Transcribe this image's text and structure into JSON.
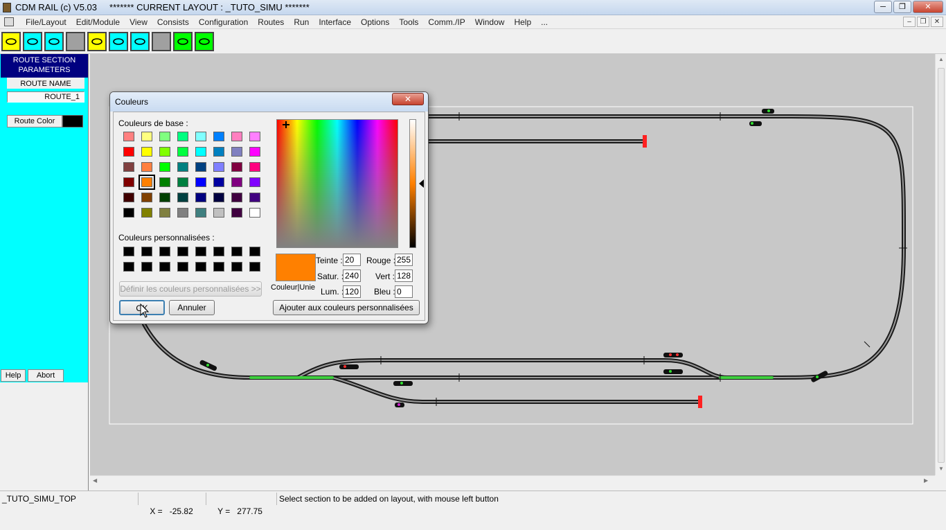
{
  "window": {
    "title": "CDM RAIL (c) V5.03     ******* CURRENT LAYOUT : _TUTO_SIMU *******",
    "minimize": "─",
    "maximize": "❐",
    "close": "✕"
  },
  "menu": {
    "items": [
      "File/Layout",
      "Edit/Module",
      "View",
      "Consists",
      "Configuration",
      "Routes",
      "Run",
      "Interface",
      "Options",
      "Tools",
      "Comm./IP",
      "Window",
      "Help",
      "..."
    ],
    "mdi_minimize": "‒",
    "mdi_restore": "❐",
    "mdi_close": "✕"
  },
  "toolbar": {
    "tools": [
      {
        "name": "loop-route-tool-icon",
        "color": "#ffff00"
      },
      {
        "name": "loop-alt-route-tool-icon",
        "color": "#00ffff"
      },
      {
        "name": "cross-loop-tool-icon",
        "color": "#00ffff"
      },
      {
        "name": "blank-tool-icon",
        "color": "#a0a0a0"
      },
      {
        "name": "buffer-stop-tool-icon",
        "color": "#ffff00"
      },
      {
        "name": "switch-track-tool-icon",
        "color": "#00ffff"
      },
      {
        "name": "cross-switch-tool-icon",
        "color": "#00ffff"
      },
      {
        "name": "blank-tool-icon-2",
        "color": "#a0a0a0"
      },
      {
        "name": "multi-track-tool-icon",
        "color": "#00ff00"
      },
      {
        "name": "oval-tool-icon",
        "color": "#00ff00"
      }
    ]
  },
  "left_panel": {
    "header_line1": "ROUTE SECTION",
    "header_line2": "PARAMETERS",
    "route_name_label": "ROUTE NAME",
    "route_name_value": "ROUTE_1",
    "route_color_button": "Route Color",
    "route_color": "#000000",
    "help_button": "Help",
    "abort_button": "Abort"
  },
  "status": {
    "layout_name": "_TUTO_SIMU_TOP",
    "x_label": "X =",
    "x_value": "-25.82",
    "y_label": "Y =",
    "y_value": "277.75",
    "message": "Select section to be added on layout, with mouse left button"
  },
  "dialog": {
    "title": "Couleurs",
    "close": "✕",
    "basic_colors_label": "Couleurs de base :",
    "basic_colors": [
      [
        "#ff8080",
        "#ffff80",
        "#80ff80",
        "#00ff80",
        "#80ffff",
        "#0080ff",
        "#ff80c0",
        "#ff80ff"
      ],
      [
        "#ff0000",
        "#ffff00",
        "#80ff00",
        "#00ff40",
        "#00ffff",
        "#0080c0",
        "#8080c0",
        "#ff00ff"
      ],
      [
        "#804040",
        "#ff8040",
        "#00ff00",
        "#008080",
        "#004080",
        "#8080ff",
        "#800040",
        "#ff0080"
      ],
      [
        "#800000",
        "#ff8000",
        "#008000",
        "#008040",
        "#0000ff",
        "#0000a0",
        "#800080",
        "#8000ff"
      ],
      [
        "#400000",
        "#804000",
        "#004000",
        "#004040",
        "#000080",
        "#000040",
        "#400040",
        "#400080"
      ],
      [
        "#000000",
        "#808000",
        "#808040",
        "#808080",
        "#408080",
        "#c0c0c0",
        "#400040",
        "#ffffff"
      ]
    ],
    "selected_row": 3,
    "selected_col": 1,
    "custom_colors_label": "Couleurs personnalisées :",
    "custom_color": "#000000",
    "define_custom_button": "Définir les couleurs personnalisées >>",
    "ok_button": "OK",
    "cancel_button": "Annuler",
    "preview_label": "Couleur|Unie",
    "preview_color": "#ff8000",
    "hue_label": "Teinte :",
    "hue_value": "20",
    "sat_label": "Satur. :",
    "sat_value": "240",
    "lum_label": "Lum. :",
    "lum_value": "120",
    "red_label": "Rouge :",
    "red_value": "255",
    "green_label": "Vert :",
    "green_value": "128",
    "blue_label": "Bleu :",
    "blue_value": "0",
    "add_custom_button": "Ajouter aux couleurs personnalisées"
  },
  "layout_canvas": {
    "background": "#c8c8c8",
    "track_color": "#1a1a1a",
    "highlight_color": "#40d040",
    "buffer_color": "#ff2020"
  }
}
